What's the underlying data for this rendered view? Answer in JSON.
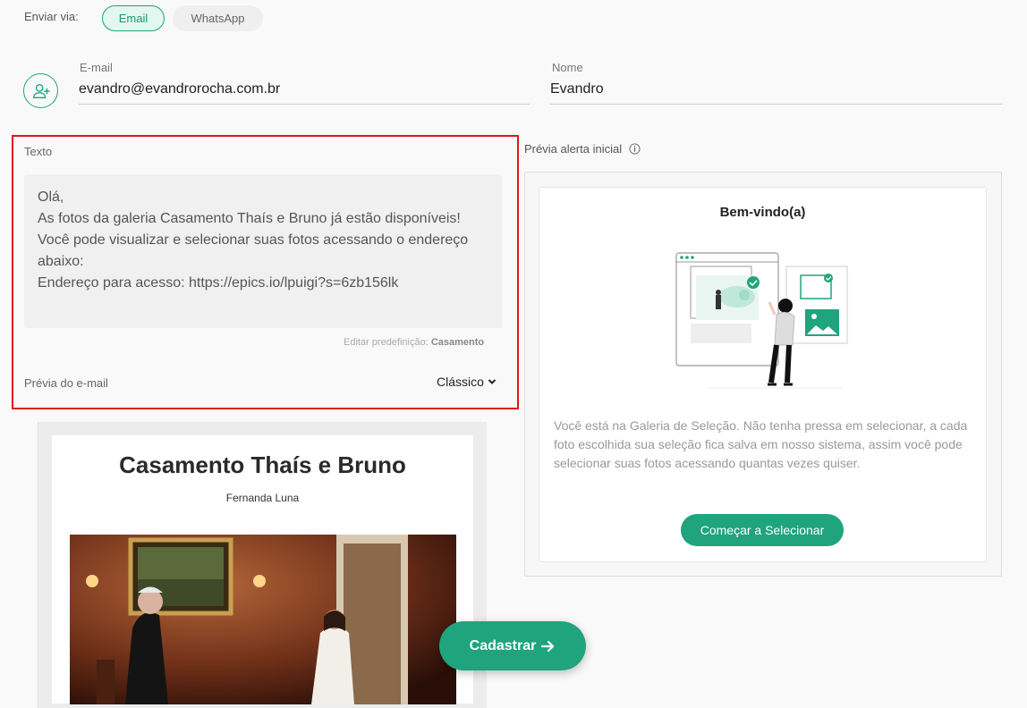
{
  "send_via": {
    "label": "Enviar via:",
    "options": [
      "Email",
      "WhatsApp"
    ],
    "selected": "Email"
  },
  "contact": {
    "email_label": "E-mail",
    "email_value": "evandro@evandrorocha.com.br",
    "name_label": "Nome",
    "name_value": "Evandro"
  },
  "message": {
    "label": "Texto",
    "body": "Olá,\nAs fotos da galeria Casamento Thaís e Bruno já estão disponíveis!\nVocê pode visualizar e selecionar suas fotos acessando o endereço abaixo:\nEndereço para acesso: https://epics.io/lpuigi?s=6zb156lk",
    "edit_preset_label": "Editar predefinição:",
    "edit_preset_value": "Casamento",
    "email_preview_label": "Prévia do e-mail",
    "style_selected": "Clássico"
  },
  "email_preview": {
    "title": "Casamento Thaís e Bruno",
    "subtitle": "Fernanda Luna"
  },
  "alert_preview": {
    "label": "Prévia alerta inicial",
    "welcome": "Bem-vindo(a)",
    "description": "Você está na Galeria de Seleção. Não tenha pressa em selecionar, a cada foto escolhida sua seleção fica salva em nosso sistema, assim você pode selecionar suas fotos acessando quantas vezes quiser.",
    "button": "Começar a Selecionar"
  },
  "submit_label": "Cadastrar",
  "colors": {
    "accent": "#1fa47d",
    "highlight_border": "#e0161d"
  }
}
